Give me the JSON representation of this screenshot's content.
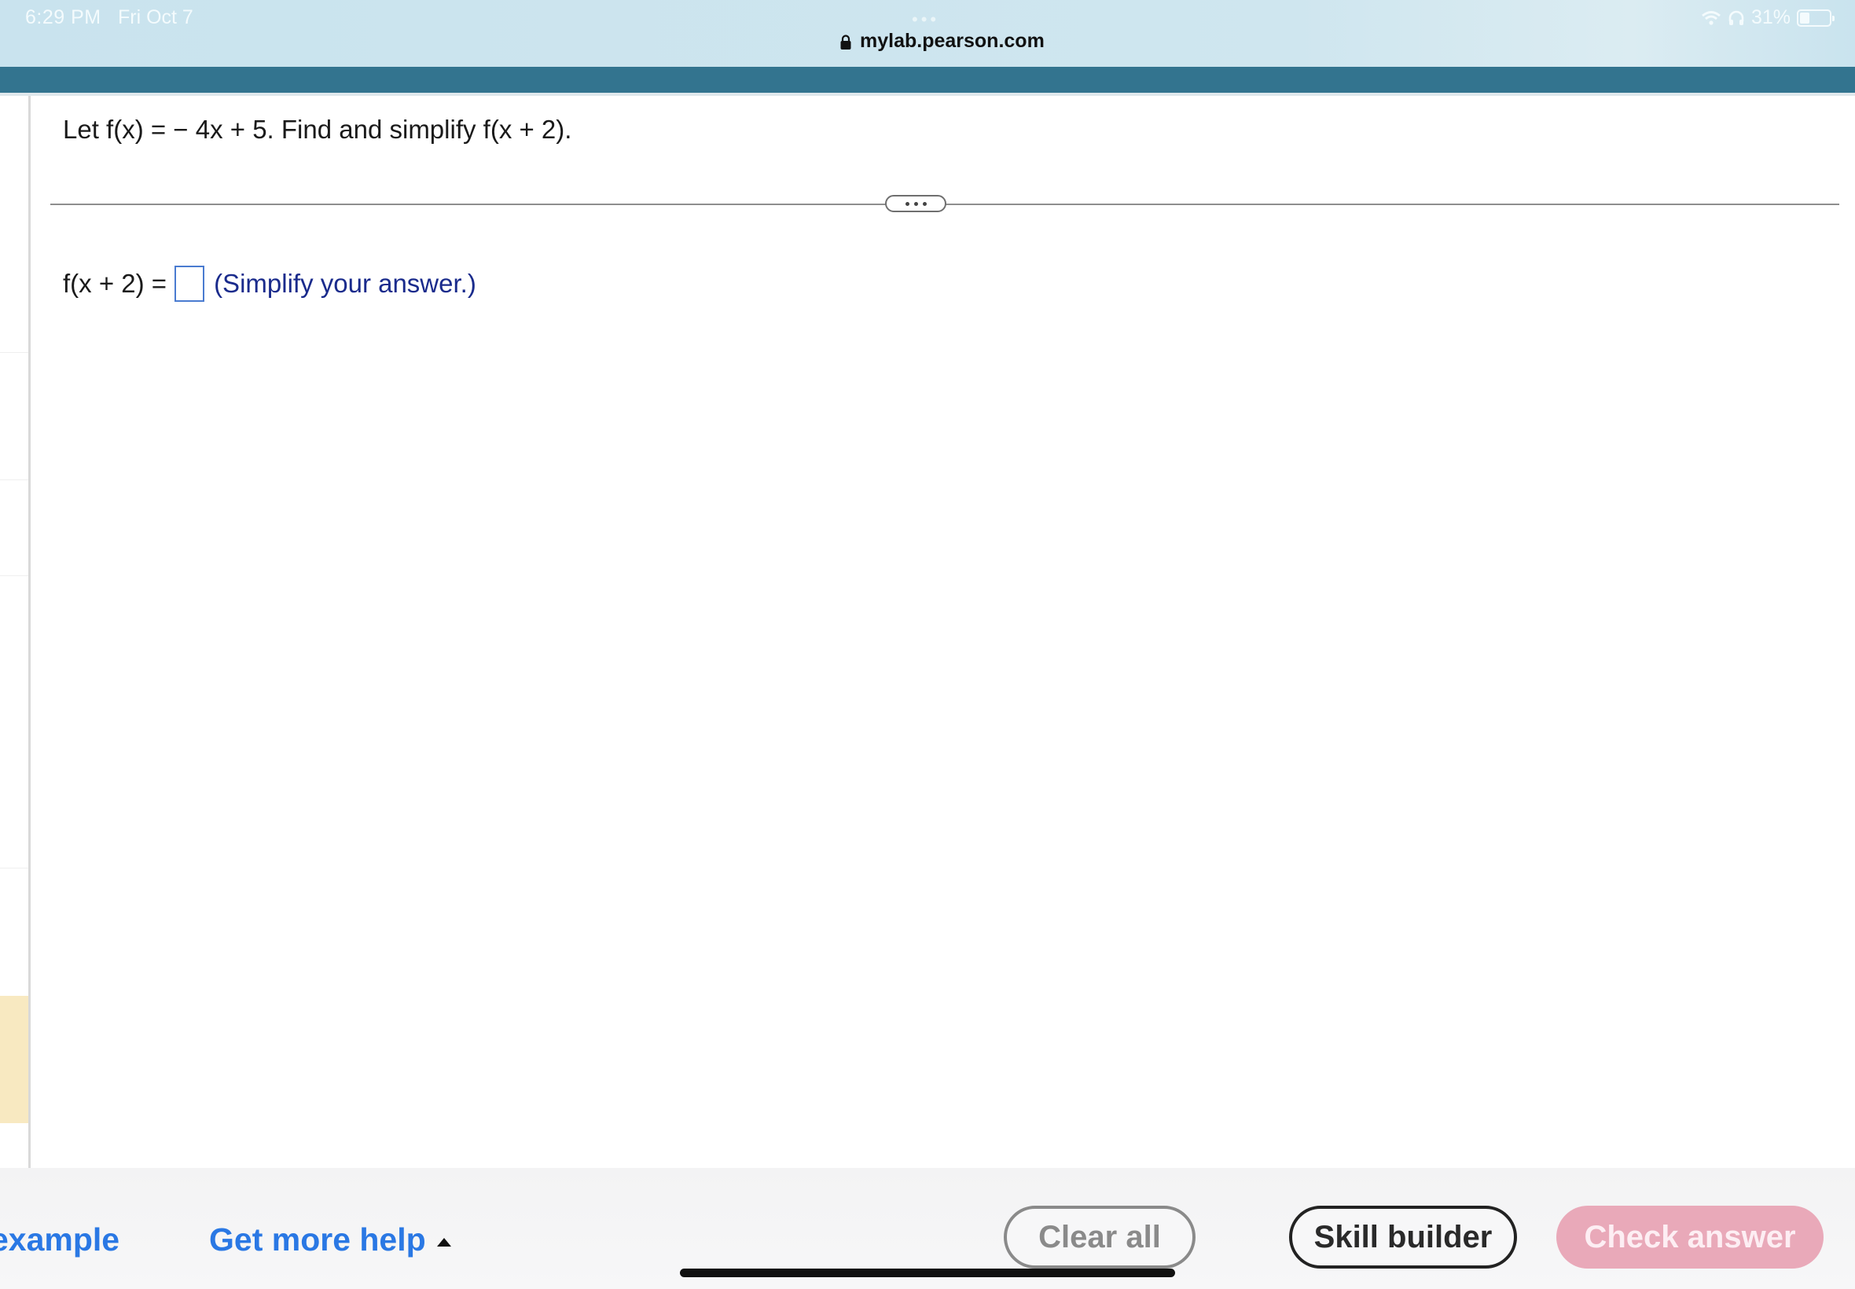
{
  "status_bar": {
    "time": "6:29 PM",
    "date": "Fri Oct 7",
    "url": "mylab.pearson.com",
    "battery": "31%"
  },
  "question": {
    "prompt": "Let f(x) = − 4x + 5. Find and simplify f(x + 2).",
    "answer_label": "f(x + 2) =",
    "answer_value": "",
    "hint": "(Simplify your answer.)"
  },
  "toolbar": {
    "example_link": "example",
    "help_link": "Get more help",
    "clear_label": "Clear all",
    "skill_label": "Skill builder",
    "check_label": "Check answer"
  },
  "colors": {
    "brand": "#33748f",
    "link": "#2a78e4",
    "check_button": "#e9a9b9",
    "hint_text": "#1a2b8c"
  }
}
